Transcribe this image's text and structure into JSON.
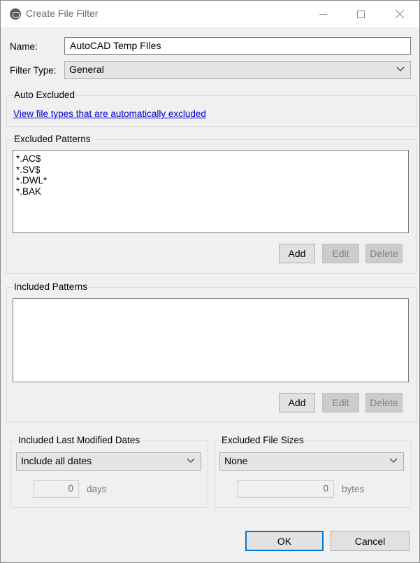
{
  "window": {
    "title": "Create File Filter"
  },
  "name_field": {
    "label": "Name:",
    "value": "AutoCAD Temp FIles"
  },
  "filter_type": {
    "label": "Filter Type:",
    "value": "General"
  },
  "auto_excluded": {
    "title": "Auto Excluded",
    "link": "View file types that are automatically excluded"
  },
  "excluded_patterns": {
    "title": "Excluded Patterns",
    "items": [
      "*.AC$",
      "*.SV$",
      "*.DWL*",
      "*.BAK"
    ],
    "add_label": "Add",
    "edit_label": "Edit",
    "delete_label": "Delete"
  },
  "included_patterns": {
    "title": "Included Patterns",
    "items": [],
    "add_label": "Add",
    "edit_label": "Edit",
    "delete_label": "Delete"
  },
  "modified_dates": {
    "title": "Included Last Modified Dates",
    "select_value": "Include all dates",
    "amount": "0",
    "unit": "days"
  },
  "file_sizes": {
    "title": "Excluded File Sizes",
    "select_value": "None",
    "amount": "0",
    "unit": "bytes"
  },
  "footer": {
    "ok_label": "OK",
    "cancel_label": "Cancel"
  },
  "icons": [
    "app-icon",
    "minimize-icon",
    "maximize-icon",
    "close-icon",
    "chevron-down-icon"
  ],
  "colors": {
    "link": "#0000cc",
    "primary_border": "#0078d7",
    "dialog_bg": "#f0f0f0"
  }
}
